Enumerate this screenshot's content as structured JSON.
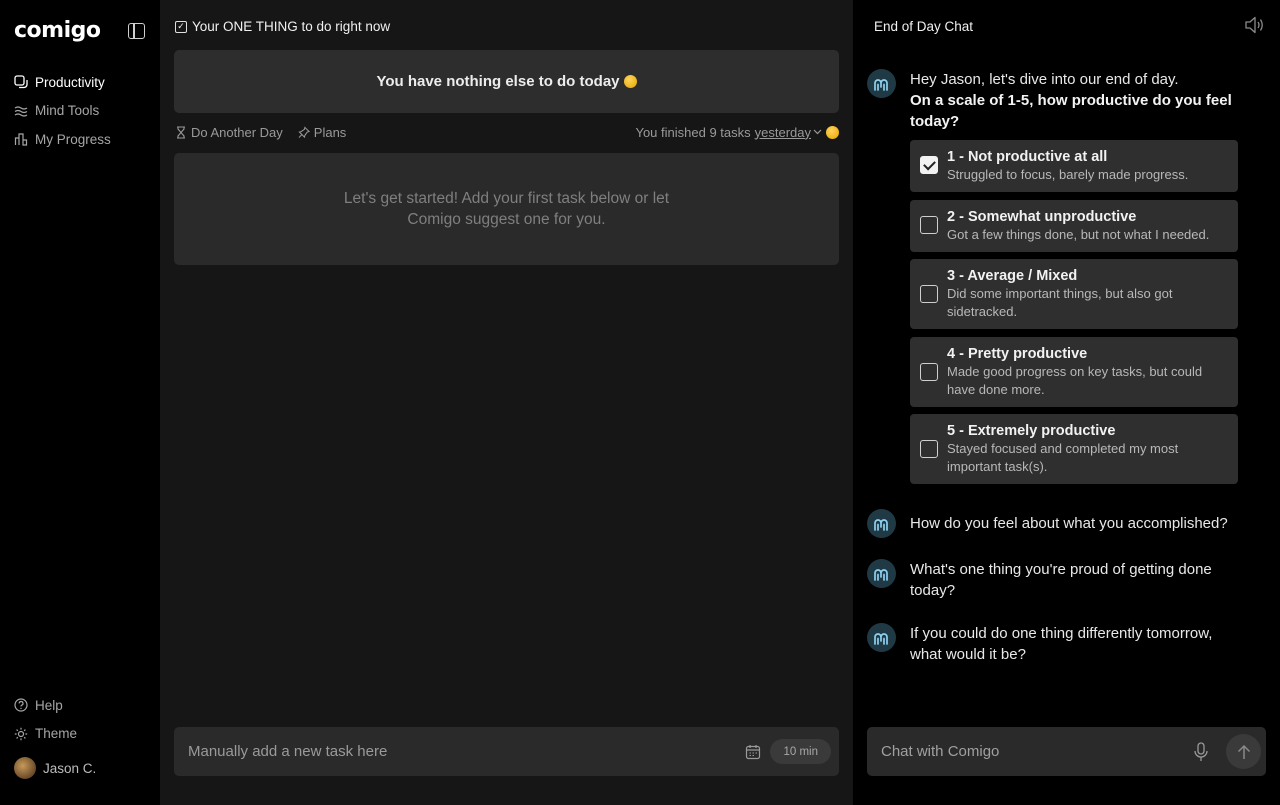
{
  "app": {
    "logo": "comigo"
  },
  "sidebar": {
    "items": [
      {
        "label": "Productivity",
        "icon": "productivity-icon",
        "active": true
      },
      {
        "label": "Mind Tools",
        "icon": "mind-tools-icon",
        "active": false
      },
      {
        "label": "My Progress",
        "icon": "progress-chart-icon",
        "active": false
      }
    ],
    "bottom": {
      "help": "Help",
      "theme": "Theme",
      "user": "Jason C."
    }
  },
  "main": {
    "one_thing_label": "Your ONE THING to do right now",
    "banner_text": "You have nothing else to do today",
    "toolbar": {
      "do_another_day": "Do Another Day",
      "plans": "Plans",
      "finished_text": "You finished 9 tasks",
      "finished_link": "yesterday"
    },
    "empty_state": "Let's get started! Add your first task below or let Comigo suggest one for you.",
    "task_input": {
      "placeholder": "Manually add a new task here",
      "duration": "10 min"
    }
  },
  "chat": {
    "title": "End of Day Chat",
    "intro": {
      "greeting": "Hey Jason, let's dive into our end of day.",
      "question": "On a scale of 1-5, how productive do you feel today?"
    },
    "options": [
      {
        "title": "1 - Not productive at all",
        "desc": "Struggled to focus, barely made progress.",
        "checked": true
      },
      {
        "title": "2 - Somewhat unproductive",
        "desc": "Got a few things done, but not what I needed.",
        "checked": false
      },
      {
        "title": "3 - Average / Mixed",
        "desc": "Did some important things, but also got sidetracked.",
        "checked": false
      },
      {
        "title": "4 - Pretty productive",
        "desc": "Made good progress on key tasks, but could have done more.",
        "checked": false
      },
      {
        "title": "5 - Extremely productive",
        "desc": "Stayed focused and completed my most important task(s).",
        "checked": false
      }
    ],
    "messages": [
      "How do you feel about what you accomplished?",
      "What's one thing you're proud of getting done today?",
      "If you could do one thing differently tomorrow, what would it be?"
    ],
    "input_placeholder": "Chat with Comigo"
  }
}
